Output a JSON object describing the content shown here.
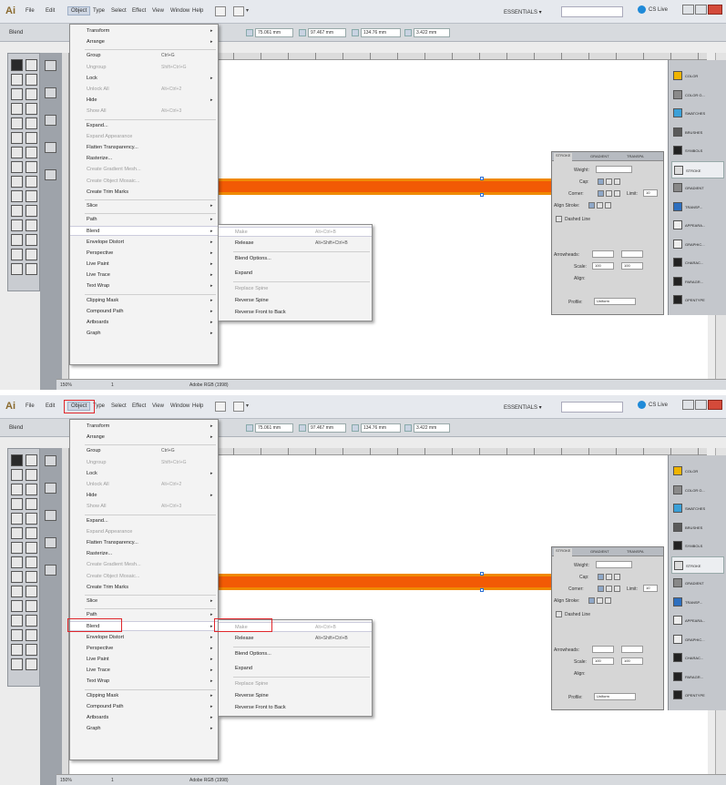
{
  "menubar": {
    "logo": "Ai",
    "items": [
      "File",
      "Edit",
      "Object",
      "Type",
      "Select",
      "Effect",
      "View",
      "Window",
      "Help"
    ],
    "workspace": "ESSENTIALS",
    "cslive": "CS Live"
  },
  "controlbar": {
    "selection": "Blend",
    "x": "75.061 mm",
    "y": "97.467 mm",
    "w": "134.76 mm",
    "h": "3.422 mm"
  },
  "object_menu": {
    "items": [
      {
        "label": "Transform",
        "shortcut": "",
        "submenu": true,
        "disabled": false
      },
      {
        "label": "Arrange",
        "shortcut": "",
        "submenu": true,
        "disabled": false
      },
      {
        "label": "Group",
        "shortcut": "Ctrl+G",
        "submenu": false,
        "disabled": false
      },
      {
        "label": "Ungroup",
        "shortcut": "Shift+Ctrl+G",
        "submenu": false,
        "disabled": true
      },
      {
        "label": "Lock",
        "shortcut": "",
        "submenu": true,
        "disabled": false
      },
      {
        "label": "Unlock All",
        "shortcut": "Alt+Ctrl+2",
        "submenu": false,
        "disabled": true
      },
      {
        "label": "Hide",
        "shortcut": "",
        "submenu": true,
        "disabled": false
      },
      {
        "label": "Show All",
        "shortcut": "Alt+Ctrl+3",
        "submenu": false,
        "disabled": true
      },
      {
        "label": "Expand...",
        "shortcut": "",
        "submenu": false,
        "disabled": false
      },
      {
        "label": "Expand Appearance",
        "shortcut": "",
        "submenu": false,
        "disabled": true
      },
      {
        "label": "Flatten Transparency...",
        "shortcut": "",
        "submenu": false,
        "disabled": false
      },
      {
        "label": "Rasterize...",
        "shortcut": "",
        "submenu": false,
        "disabled": false
      },
      {
        "label": "Create Gradient Mesh...",
        "shortcut": "",
        "submenu": false,
        "disabled": true
      },
      {
        "label": "Create Object Mosaic...",
        "shortcut": "",
        "submenu": false,
        "disabled": true
      },
      {
        "label": "Create Trim Marks",
        "shortcut": "",
        "submenu": false,
        "disabled": false
      },
      {
        "label": "Slice",
        "shortcut": "",
        "submenu": true,
        "disabled": false
      },
      {
        "label": "Path",
        "shortcut": "",
        "submenu": true,
        "disabled": false
      },
      {
        "label": "Blend",
        "shortcut": "",
        "submenu": true,
        "disabled": false
      },
      {
        "label": "Envelope Distort",
        "shortcut": "",
        "submenu": true,
        "disabled": false
      },
      {
        "label": "Perspective",
        "shortcut": "",
        "submenu": true,
        "disabled": false
      },
      {
        "label": "Live Paint",
        "shortcut": "",
        "submenu": true,
        "disabled": false
      },
      {
        "label": "Live Trace",
        "shortcut": "",
        "submenu": true,
        "disabled": false
      },
      {
        "label": "Text Wrap",
        "shortcut": "",
        "submenu": true,
        "disabled": false
      },
      {
        "label": "Clipping Mask",
        "shortcut": "",
        "submenu": true,
        "disabled": false
      },
      {
        "label": "Compound Path",
        "shortcut": "",
        "submenu": true,
        "disabled": false
      },
      {
        "label": "Artboards",
        "shortcut": "",
        "submenu": true,
        "disabled": false
      },
      {
        "label": "Graph",
        "shortcut": "",
        "submenu": true,
        "disabled": false
      }
    ]
  },
  "blend_menu": {
    "items": [
      {
        "label": "Make",
        "shortcut": "Alt+Ctrl+B",
        "disabled": true
      },
      {
        "label": "Release",
        "shortcut": "Alt+Shift+Ctrl+B",
        "disabled": false
      },
      {
        "label": "Blend Options...",
        "shortcut": "",
        "disabled": false
      },
      {
        "label": "Expand",
        "shortcut": "",
        "disabled": false
      },
      {
        "label": "Replace Spine",
        "shortcut": "",
        "disabled": true
      },
      {
        "label": "Reverse Spine",
        "shortcut": "",
        "disabled": false
      },
      {
        "label": "Reverse Front to Back",
        "shortcut": "",
        "disabled": false
      }
    ]
  },
  "stroke_panel": {
    "tabs": [
      "STROKE",
      "GRADIENT",
      "TRANSPA"
    ],
    "weight_label": "Weight:",
    "cap_label": "Cap:",
    "corner_label": "Corner:",
    "limit_label": "Limit:",
    "limit_value": "10",
    "align_label": "Align Stroke:",
    "dashed_label": "Dashed Line",
    "arrowheads_label": "Arrowheads:",
    "scale_label": "Scale:",
    "scale_values": [
      "100",
      "100"
    ],
    "align_arrows_label": "Align:",
    "profile_label": "Profile:",
    "profile_value": "Uniform"
  },
  "right_panels": {
    "items": [
      "COLOR",
      "COLOR G...",
      "SWATCHES",
      "BRUSHES",
      "SYMBOLS",
      "STROKE",
      "GRADIENT",
      "TRANSP...",
      "APPEARA...",
      "GRAPHIC...",
      "CHARAC...",
      "PARAGR...",
      "OPENTYPE"
    ]
  },
  "statusbar": {
    "zoom": "150%",
    "page": "1",
    "document": "Adobe RGB (1998)"
  },
  "colors": {
    "stroke_orange": "#f25a05",
    "callout_red": "#e0272c"
  }
}
